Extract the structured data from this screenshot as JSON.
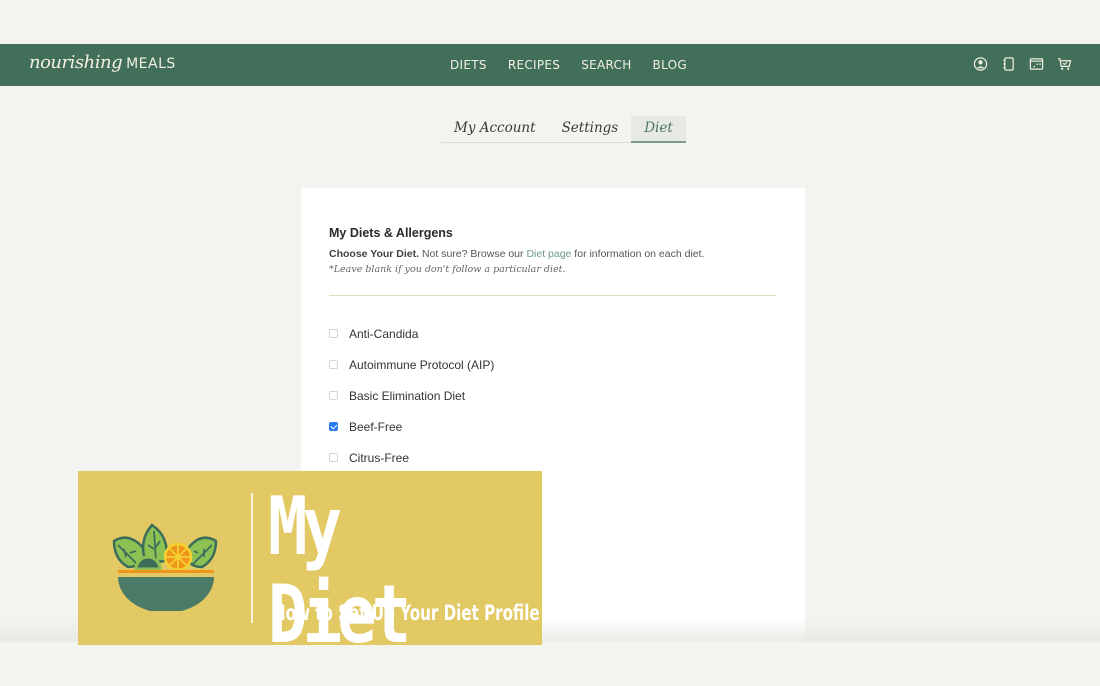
{
  "brand": {
    "script": "nourishing",
    "caps": "MEALS"
  },
  "nav": {
    "links": [
      "DIETS",
      "RECIPES",
      "SEARCH",
      "BLOG"
    ],
    "icons": [
      "account-icon",
      "notebook-icon",
      "calendar-icon",
      "cart-icon"
    ]
  },
  "tabs": [
    {
      "label": "My Account",
      "active": false
    },
    {
      "label": "Settings",
      "active": false
    },
    {
      "label": "Diet",
      "active": true
    }
  ],
  "card": {
    "title": "My Diets & Allergens",
    "desc_bold": "Choose Your Diet.",
    "desc_pre": " Not sure? Browse our ",
    "desc_link": "Diet page",
    "desc_post": " for information on each diet.",
    "note": "*Leave blank if you don't follow a particular diet.",
    "diets": [
      {
        "label": "Anti-Candida",
        "checked": false
      },
      {
        "label": "Autoimmune Protocol (AIP)",
        "checked": false
      },
      {
        "label": "Basic Elimination Diet",
        "checked": false
      },
      {
        "label": "Beef-Free",
        "checked": true
      },
      {
        "label": "Citrus-Free",
        "checked": false
      }
    ]
  },
  "banner": {
    "title": "My Diet",
    "subtitle": "How to Set Up Your Diet Profile",
    "bg_color": "#e2c963"
  },
  "colors": {
    "nav_green": "#426f59",
    "link_green": "#6b9a86",
    "checkbox_blue": "#2d7bf4"
  }
}
